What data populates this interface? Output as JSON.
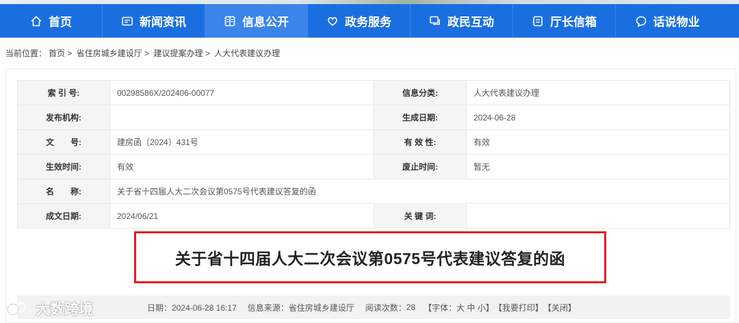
{
  "nav": {
    "items": [
      {
        "label": "首页",
        "icon": "home-icon"
      },
      {
        "label": "新闻资讯",
        "icon": "news-icon"
      },
      {
        "label": "信息公开",
        "icon": "document-icon"
      },
      {
        "label": "政务服务",
        "icon": "service-icon"
      },
      {
        "label": "政民互动",
        "icon": "chat-icon"
      },
      {
        "label": "厅长信箱",
        "icon": "mailbox-icon"
      },
      {
        "label": "话说物业",
        "icon": "speech-icon"
      }
    ],
    "active": "信息公开",
    "bg_color": "#1a6fe0",
    "active_color": "#3a84ea"
  },
  "breadcrumb": {
    "prefix": "当前位置：",
    "items": [
      "首页",
      "省住房城乡建设厅",
      "建议提案办理",
      "人大代表建议办理"
    ],
    "separator": ">"
  },
  "meta": {
    "index_label": "索 引 号:",
    "index_value": "00298586X/202406-00077",
    "category_label": "信息分类:",
    "category_value": "人大代表建议办理",
    "publisher_label": "发布机构:",
    "publisher_value": "",
    "created_label": "生成日期:",
    "created_value": "2024-06-28",
    "docno_label": "文　　号:",
    "docno_value": "建房函〔2024〕431号",
    "validity_label": "有 效 性:",
    "validity_value": "有效",
    "effective_label": "生效时间:",
    "effective_value": "有效",
    "expire_label": "废止时间:",
    "expire_value": "暂无",
    "name_label": "名　　称:",
    "name_value": "关于省十四届人大二次会议第0575号代表建议答复的函",
    "written_label": "成文日期:",
    "written_value": "2024/06/21",
    "keywords_label": "关 键 词:",
    "keywords_value": ""
  },
  "article": {
    "title": "关于省十四届人大二次会议第0575号代表建议答复的函",
    "highlight_color": "#e01e24"
  },
  "infobar": {
    "date": "日期：2024-06-28 16:17",
    "source": "信息来源：省住房城乡建设厅",
    "views_label": "阅读次数：",
    "views": "28",
    "font_prefix": "【字体：",
    "font_large": "大",
    "font_medium": "中",
    "font_small": "小",
    "font_suffix": "】",
    "print": "【我要打印】",
    "close": "【关闭】"
  },
  "watermark": {
    "text": "大数跨境"
  }
}
